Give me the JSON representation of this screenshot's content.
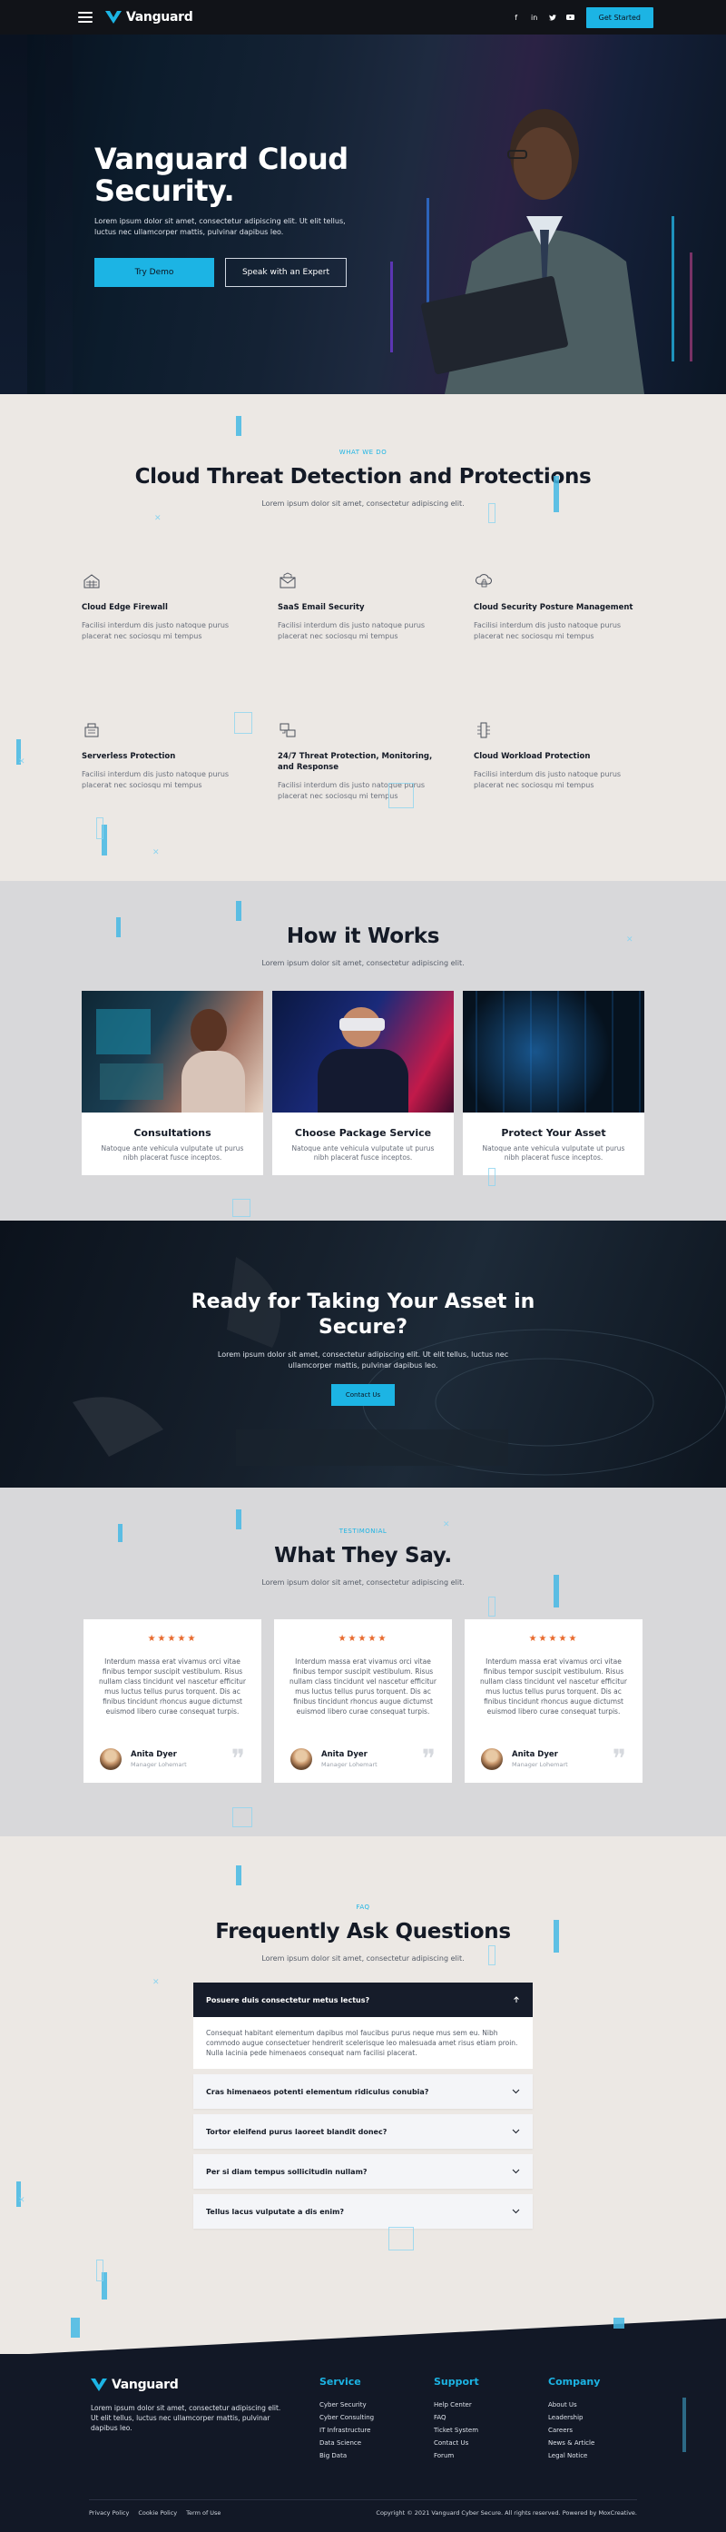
{
  "nav": {
    "brand": "Vanguard",
    "social_icons": [
      "facebook-icon",
      "linkedin-icon",
      "twitter-icon",
      "youtube-icon"
    ],
    "cta_label": "Get Started"
  },
  "hero": {
    "title": "Vanguard Cloud Security.",
    "subtitle": "Lorem ipsum dolor sit amet, consectetur adipiscing elit. Ut elit tellus, luctus nec ullamcorper mattis, pulvinar dapibus leo.",
    "primary_button": "Try Demo",
    "secondary_button": "Speak with an Expert"
  },
  "services": {
    "eyebrow": "WHAT WE DO",
    "title": "Cloud Threat Detection and Protections",
    "subtitle": "Lorem ipsum dolor sit amet, consectetur adipiscing elit.",
    "items": [
      {
        "icon": "firewall-icon",
        "title": "Cloud Edge Firewall",
        "text": "Facilisi interdum dis justo natoque purus placerat nec sociosqu mi tempus"
      },
      {
        "icon": "email-security-icon",
        "title": "SaaS Email Security",
        "text": "Facilisi interdum dis justo natoque purus placerat nec sociosqu mi tempus"
      },
      {
        "icon": "cloud-security-icon",
        "title": "Cloud Security Posture Management",
        "text": "Facilisi interdum dis justo natoque purus placerat nec sociosqu mi tempus"
      },
      {
        "icon": "serverless-icon",
        "title": "Serverless Protection",
        "text": "Facilisi interdum dis justo natoque purus placerat nec sociosqu mi tempus"
      },
      {
        "icon": "threat-monitoring-icon",
        "title": "24/7 Threat Protection, Monitoring, and Response",
        "text": "Facilisi interdum dis justo natoque purus placerat nec sociosqu mi tempus"
      },
      {
        "icon": "workload-icon",
        "title": "Cloud Workload Protection",
        "text": "Facilisi interdum dis justo natoque purus placerat nec sociosqu mi tempus"
      }
    ]
  },
  "how": {
    "title": "How it Works",
    "subtitle": "Lorem ipsum dolor sit amet, consectetur adipiscing elit.",
    "cards": [
      {
        "title": "Consultations",
        "text": "Natoque ante vehicula vulputate ut purus nibh placerat fusce inceptos."
      },
      {
        "title": "Choose Package Service",
        "text": "Natoque ante vehicula vulputate ut purus nibh placerat fusce inceptos."
      },
      {
        "title": "Protect Your Asset",
        "text": "Natoque ante vehicula vulputate ut purus nibh placerat fusce inceptos."
      }
    ]
  },
  "cta": {
    "title": "Ready for Taking Your Asset in Secure?",
    "subtitle": "Lorem ipsum dolor sit amet, consectetur adipiscing elit. Ut elit tellus, luctus nec ullamcorper mattis, pulvinar dapibus leo.",
    "button": "Contact Us"
  },
  "testimonials": {
    "eyebrow": "TESTIMONIAL",
    "title": "What They Say.",
    "subtitle": "Lorem ipsum dolor sit amet, consectetur adipiscing elit.",
    "items": [
      {
        "stars": "★★★★★",
        "text": "Interdum massa erat vivamus orci vitae finibus tempor suscipit vestibulum. Risus nullam class tincidunt vel nascetur efficitur mus luctus tellus purus torquent. Dis ac finibus tincidunt rhoncus augue dictumst euismod libero curae consequat turpis.",
        "name": "Anita Dyer",
        "role": "Manager Lohemart"
      },
      {
        "stars": "★★★★★",
        "text": "Interdum massa erat vivamus orci vitae finibus tempor suscipit vestibulum. Risus nullam class tincidunt vel nascetur efficitur mus luctus tellus purus torquent. Dis ac finibus tincidunt rhoncus augue dictumst euismod libero curae consequat turpis.",
        "name": "Anita Dyer",
        "role": "Manager Lohemart"
      },
      {
        "stars": "★★★★★",
        "text": "Interdum massa erat vivamus orci vitae finibus tempor suscipit vestibulum. Risus nullam class tincidunt vel nascetur efficitur mus luctus tellus purus torquent. Dis ac finibus tincidunt rhoncus augue dictumst euismod libero curae consequat turpis.",
        "name": "Anita Dyer",
        "role": "Manager Lohemart"
      }
    ]
  },
  "faq": {
    "eyebrow": "FAQ",
    "title": "Frequently Ask Questions",
    "subtitle": "Lorem ipsum dolor sit amet, consectetur adipiscing elit.",
    "open": {
      "question": "Posuere duis consectetur metus lectus?",
      "answer": "Consequat habitant elementum dapibus mol faucibus purus neque mus sem eu. Nibh commodo augue consectetuer hendrerit scelerisque leo malesuada amet risus etiam proin. Nulla lacinia pede himenaeos consequat nam facilisi placerat."
    },
    "items": [
      "Cras himenaeos potenti elementum ridiculus conubia?",
      "Tortor eleifend purus laoreet blandit donec?",
      "Per si diam tempus sollicitudin nullam?",
      "Tellus lacus vulputate a dis enim?"
    ]
  },
  "footer": {
    "brand": "Vanguard",
    "description": "Lorem ipsum dolor sit amet, consectetur adipiscing elit. Ut elit tellus, luctus nec ullamcorper mattis, pulvinar dapibus leo.",
    "columns": [
      {
        "title": "Service",
        "links": [
          "Cyber Security",
          "Cyber Consulting",
          "IT Infrastructure",
          "Data Science",
          "Big Data"
        ]
      },
      {
        "title": "Support",
        "links": [
          "Help Center",
          "FAQ",
          "Ticket System",
          "Contact Us",
          "Forum"
        ]
      },
      {
        "title": "Company",
        "links": [
          "About Us",
          "Leadership",
          "Careers",
          "News & Article",
          "Legal Notice"
        ]
      }
    ],
    "bottom_links": [
      "Privacy Policy",
      "Cookie Policy",
      "Term of Use"
    ],
    "copyright": "Copyright © 2021 Vanguard Cyber Secure. All rights reserved. Powered by MoxCreative."
  },
  "colors": {
    "accent": "#1cb4e4",
    "dark": "#121826",
    "beige": "#ece8e4",
    "gray": "#d8d8da",
    "star": "#e8692c"
  }
}
